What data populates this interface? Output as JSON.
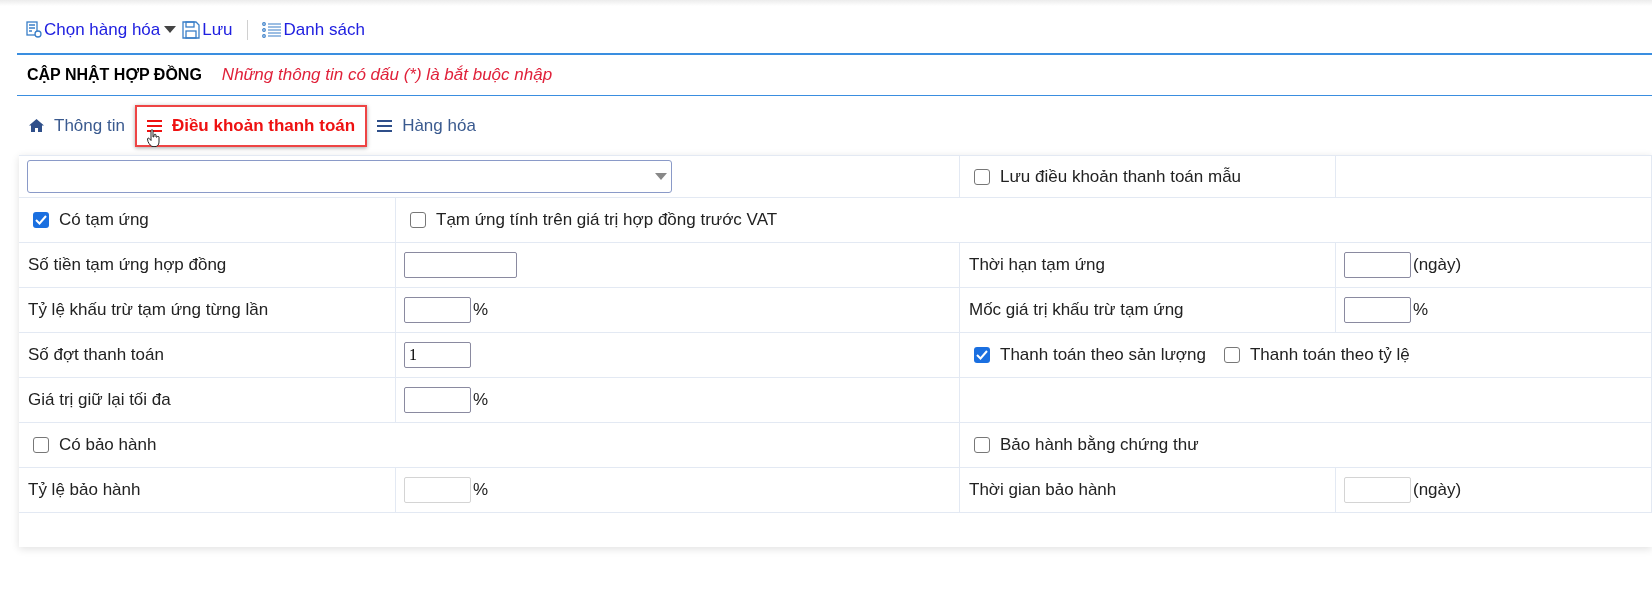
{
  "toolbar": [
    {
      "label": "Chọn hàng hóa"
    },
    {
      "label": "Lưu"
    },
    {
      "label": "Danh sách"
    }
  ],
  "form_title": "CẬP NHẬT HỢP ĐỒNG",
  "required_note": "Những thông tin có dấu (*) là bắt buộc nhập",
  "tabs": [
    {
      "label": "Thông tin",
      "selected": false
    },
    {
      "label": "Điều khoản thanh toán",
      "selected": true
    },
    {
      "label": "Hàng hóa",
      "selected": false
    }
  ],
  "rows": [
    [
      {
        "kind": "select"
      },
      {
        "kind": "checkboxes",
        "items": [
          {
            "label": "Lưu điều khoản thanh toán mẫu",
            "checked": false
          }
        ]
      },
      {
        "kind": "empty"
      }
    ],
    [
      {
        "kind": "checkboxes",
        "items": [
          {
            "label": "Có tạm ứng",
            "checked": true
          }
        ]
      },
      {
        "kind": "checkboxes",
        "items": [
          {
            "label": "Tạm ứng tính trên giá trị hợp đồng trước VAT",
            "checked": false
          }
        ]
      }
    ],
    [
      {
        "kind": "label",
        "text": "Số tiền tạm ứng hợp đồng"
      },
      {
        "kind": "wide_input",
        "disabled": false
      },
      {
        "kind": "label",
        "text": "Thời hạn tạm ứng"
      },
      {
        "kind": "input",
        "disabled": false,
        "unit": "(ngày)"
      }
    ],
    [
      {
        "kind": "label",
        "text": "Tỷ lệ khấu trừ tạm ứng từng lần"
      },
      {
        "kind": "input",
        "disabled": false,
        "unit": "%"
      },
      {
        "kind": "label",
        "text": "Mốc giá trị khấu trừ tạm ứng"
      },
      {
        "kind": "input",
        "disabled": false,
        "unit": "%"
      }
    ],
    [
      {
        "kind": "label",
        "text": "Số đợt thanh toán"
      },
      {
        "kind": "input",
        "disabled": false,
        "value": "1"
      },
      {
        "kind": "checkboxes",
        "items": [
          {
            "label": "Thanh toán theo sản lượng",
            "checked": true
          },
          {
            "label": "Thanh toán theo tỷ lệ",
            "checked": false
          }
        ]
      }
    ],
    [
      {
        "kind": "label",
        "text": "Giá trị giữ lại tối đa"
      },
      {
        "kind": "input",
        "disabled": false,
        "unit": "%"
      },
      {
        "kind": "empty"
      }
    ],
    [
      {
        "kind": "checkboxes",
        "items": [
          {
            "label": "Có bảo hành",
            "checked": false
          }
        ]
      },
      {
        "kind": "checkboxes",
        "items": [
          {
            "label": "Bảo hành bằng chứng thư",
            "checked": false
          }
        ]
      }
    ],
    [
      {
        "kind": "label",
        "text": "Tỷ lệ bảo hành"
      },
      {
        "kind": "input",
        "disabled": true,
        "unit": "%"
      },
      {
        "kind": "label",
        "text": "Thời gian bảo hành"
      },
      {
        "kind": "input",
        "disabled": true,
        "unit": "(ngày)"
      }
    ]
  ]
}
